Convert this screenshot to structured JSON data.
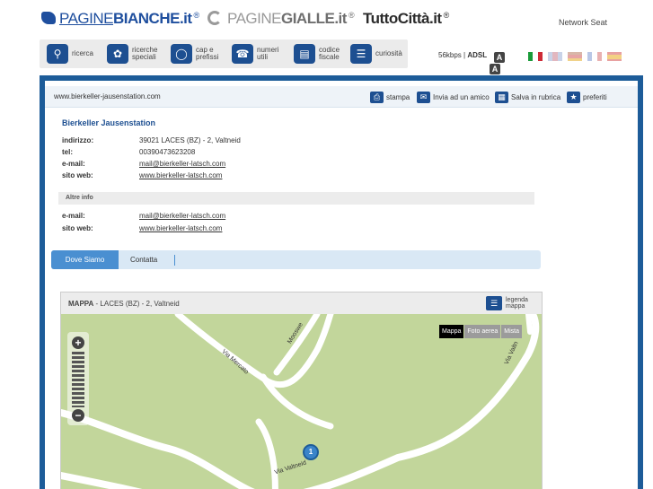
{
  "brands": {
    "pb_l1": "PAGINE",
    "pb_l2": "BIANCHE",
    "pb_suffix": ".it",
    "pg_l1": "PAGINE",
    "pg_l2": "GIALLE",
    "pg_suffix": ".it",
    "tc": "TuttoCittà.it",
    "registered": "®",
    "network": "Network Seat"
  },
  "services": [
    {
      "label": "ricerca",
      "icon": "search-icon"
    },
    {
      "label": "ricerche speciali",
      "icon": "clover-icon"
    },
    {
      "label": "cap e prefissi",
      "icon": "globe-icon"
    },
    {
      "label": "numeri utili",
      "icon": "phone-icon"
    },
    {
      "label": "codice fiscale",
      "icon": "id-card-icon"
    },
    {
      "label": "curiosità",
      "icon": "book-icon"
    }
  ],
  "connection": {
    "speed": "56kbps",
    "sep": "|",
    "type": "ADSL"
  },
  "font_size": {
    "a1": "A",
    "a2": "A"
  },
  "flags": [
    {
      "name": "italian",
      "colors": [
        "#1a9b3a",
        "#ffffff",
        "#ce2b37"
      ]
    },
    {
      "name": "english",
      "colors": [
        "#c9d3e8",
        "#e2b7bf",
        "#c9d3e8"
      ]
    },
    {
      "name": "german",
      "colors": [
        "#d8b7a8",
        "#e6a5a5",
        "#f0d28a"
      ]
    },
    {
      "name": "french",
      "colors": [
        "#b9c7e6",
        "#ffffff",
        "#e9b1b1"
      ]
    },
    {
      "name": "spanish",
      "colors": [
        "#e8a1a1",
        "#f3d183",
        "#e8a1a1"
      ]
    }
  ],
  "toolbar": {
    "url": "www.bierkeller-jausenstation.com",
    "stampa": "stampa",
    "invia": "Invia ad un amico",
    "salva": "Salva in rubrica",
    "preferiti": "preferiti"
  },
  "listing": {
    "name": "Bierkeller Jausenstation",
    "rows": [
      {
        "key": "indirizzo:",
        "value": "39021 LACES (BZ) - 2, Valtneid"
      },
      {
        "key": "tel:",
        "value": "00390473623208"
      },
      {
        "key": "e-mail:",
        "value": "mail@bierkeller-latsch.com"
      },
      {
        "key": "sito web:",
        "value": "www.bierkeller-latsch.com"
      }
    ],
    "altre_title": "Altre info",
    "altre_rows": [
      {
        "key": "e-mail:",
        "value": "mail@bierkeller-latsch.com"
      },
      {
        "key": "sito web:",
        "value": "www.bierkeller-latsch.com"
      }
    ]
  },
  "tabs": [
    {
      "label": "Dove Siamo"
    },
    {
      "label": "Contatta"
    }
  ],
  "map": {
    "title": "MAPPA",
    "subtitle": " - LACES (BZ) - 2, Valtneid",
    "legenda_l1": "legenda",
    "legenda_l2": "mappa",
    "types": [
      "Mappa",
      "Foto aerea",
      "Mista"
    ],
    "selected_type": "Mappa",
    "roads": [
      "Via Mercato",
      "Mooswe",
      "Via Valtn",
      "Via Valtneid"
    ],
    "zoom_in": "+",
    "zoom_out": "−",
    "pin_label": "1",
    "colors": {
      "land": "#c2d69b",
      "road": "#ffffff"
    }
  }
}
